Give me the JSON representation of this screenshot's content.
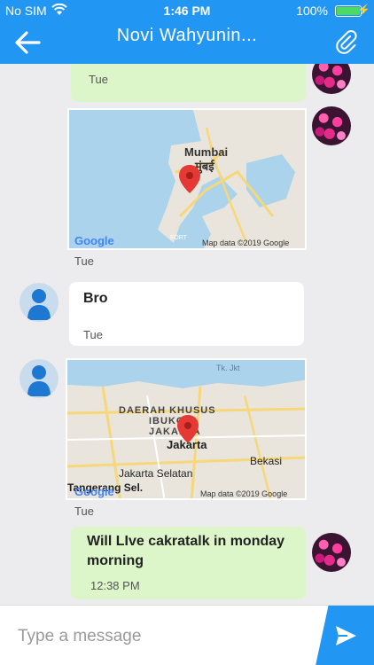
{
  "status_bar": {
    "carrier": "No SIM",
    "time": "1:46 PM",
    "battery_percent": "100%",
    "battery_level": 1.0,
    "battery_color": "#4cd964"
  },
  "header": {
    "title": "Novi Wahyunin...",
    "back_icon": "arrow-left-icon",
    "attach_icon": "paperclip-icon",
    "background": "#2196f3"
  },
  "messages": [
    {
      "type": "text",
      "direction": "outgoing",
      "text": "",
      "time": "Tue"
    },
    {
      "type": "location",
      "direction": "outgoing",
      "map_labels": [
        "Mumbai",
        "मुंबई",
        "FORT"
      ],
      "map_brand": "Google",
      "map_credit": "Map data ©2019 Google",
      "time": "Tue"
    },
    {
      "type": "text",
      "direction": "incoming",
      "text": "Bro",
      "time": "Tue"
    },
    {
      "type": "location",
      "direction": "incoming",
      "map_labels": [
        "Tk. Jkt",
        "DAERAH KHUSUS",
        "IBUKOTA",
        "JAKARTA",
        "Jakarta",
        "Bekasi",
        "Jakarta Selatan",
        "Tangerang Sel."
      ],
      "map_brand": "Google",
      "map_credit": "Map data ©2019 Google",
      "time": "Tue"
    },
    {
      "type": "text",
      "direction": "outgoing",
      "text": "Will LIve cakratalk in monday morning",
      "time": "12:38 PM"
    }
  ],
  "composer": {
    "placeholder": "Type a message",
    "send_icon": "send-icon"
  },
  "colors": {
    "outgoing_bubble": "#ddf6c9",
    "incoming_bubble": "#ffffff",
    "chat_background": "#ececef"
  }
}
